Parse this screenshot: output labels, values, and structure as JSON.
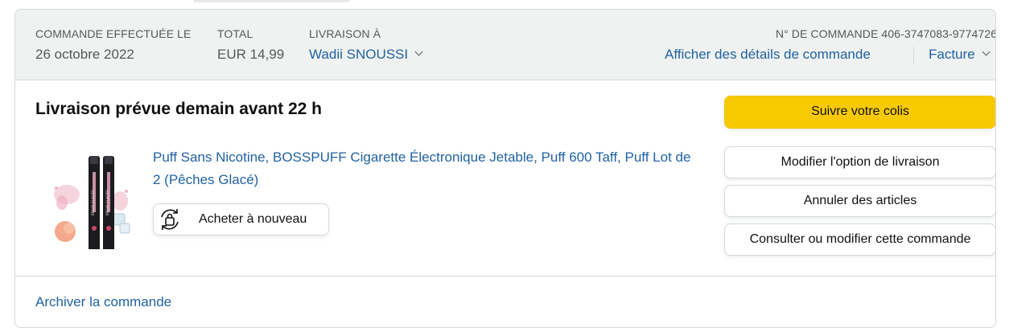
{
  "header": {
    "order_placed_label": "COMMANDE EFFECTUÉE LE",
    "order_placed_value": "26 octobre 2022",
    "total_label": "TOTAL",
    "total_value": "EUR 14,99",
    "ship_to_label": "LIVRAISON À",
    "ship_to_name": "Wadii SNOUSSI",
    "order_number_label": "N° DE COMMANDE 406-3747083-9774726",
    "order_details_link": "Afficher des détails de commande",
    "invoice_link": "Facture"
  },
  "shipment": {
    "status_title": "Livraison prévue demain avant 22 h"
  },
  "item": {
    "title": "Puff Sans Nicotine, BOSSPUFF Cigarette Électronique Jetable, Puff 600 Taff, Puff Lot de 2 (Pêches Glacé)",
    "buy_again_label": "Acheter à nouveau",
    "image_text": "BREAK GLACIER"
  },
  "actions": {
    "track_package": "Suivre votre colis",
    "change_delivery": "Modifier l'option de livraison",
    "cancel_items": "Annuler des articles",
    "view_edit_order": "Consulter ou modifier cette commande"
  },
  "footer": {
    "archive_link": "Archiver la commande"
  },
  "colors": {
    "link": "#2162a1",
    "primary_button": "#f7ca00",
    "header_bg": "#f0f2f2",
    "border": "#d5d9d9"
  },
  "icons": {
    "buy_again": "reorder-bag-icon",
    "dropdown": "chevron-down-icon"
  }
}
